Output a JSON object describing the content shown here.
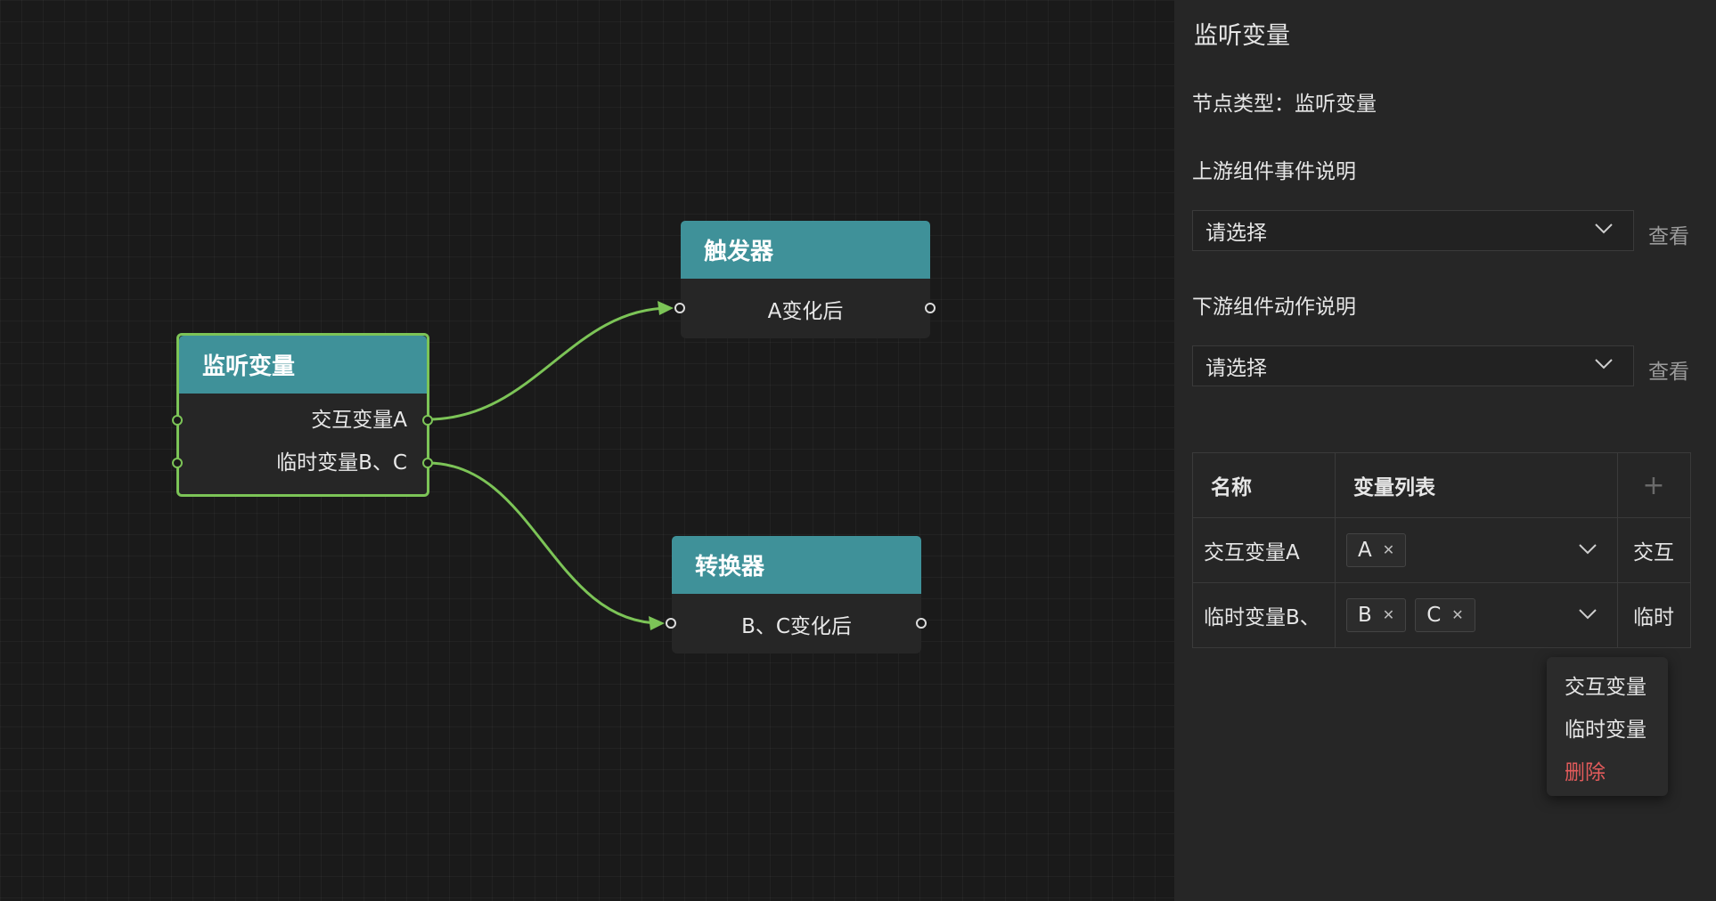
{
  "canvas": {
    "nodes": {
      "listen": {
        "title": "监听变量",
        "rows": [
          "交互变量A",
          "临时变量B、C"
        ]
      },
      "trigger": {
        "title": "触发器",
        "row": "A变化后"
      },
      "converter": {
        "title": "转换器",
        "row": "B、C变化后"
      }
    },
    "colors": {
      "node_header": "#3f9199",
      "edge": "#7cc457",
      "selected_border": "#7cc457"
    }
  },
  "panel": {
    "title": "监听变量",
    "node_type": "节点类型：监听变量",
    "upstream_label": "上游组件事件说明",
    "upstream_select": "请选择",
    "upstream_link": "查看",
    "downstream_label": "下游组件动作说明",
    "downstream_select": "请选择",
    "downstream_link": "查看",
    "table": {
      "headers": {
        "name": "名称",
        "vars": "变量列表",
        "add": "+"
      },
      "rows": [
        {
          "name": "交互变量A",
          "tags": [
            "A"
          ],
          "type": "交互"
        },
        {
          "name": "临时变量B、",
          "tags": [
            "B",
            "C"
          ],
          "type": "临时"
        }
      ]
    },
    "context_menu": {
      "items": [
        "交互变量",
        "临时变量",
        "删除"
      ],
      "danger_color": "#e25b5b"
    }
  }
}
